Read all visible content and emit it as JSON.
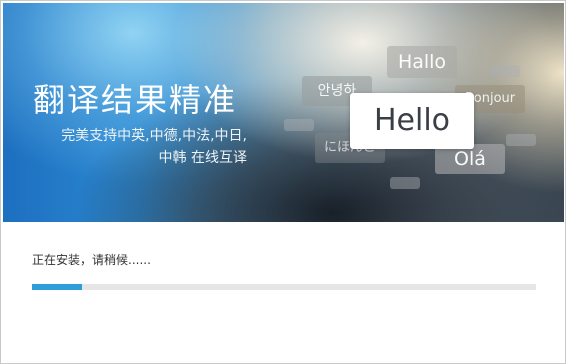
{
  "banner": {
    "title": "翻译结果精准",
    "subtitle_line1": "完美支持中英,中德,中法,中日,",
    "subtitle_line2": "中韩 在线互译",
    "bubbles": {
      "hallo": "Hallo",
      "korean": "안녕하",
      "bonjour": "Bonjour",
      "nihongo": "にほんご",
      "ola": "Olá",
      "hello": "Hello"
    }
  },
  "install": {
    "status": "正在安装，请稍候......",
    "progress_percent": 10
  },
  "colors": {
    "progress_fill": "#2d9fd8",
    "progress_track": "#e6e6e6"
  }
}
